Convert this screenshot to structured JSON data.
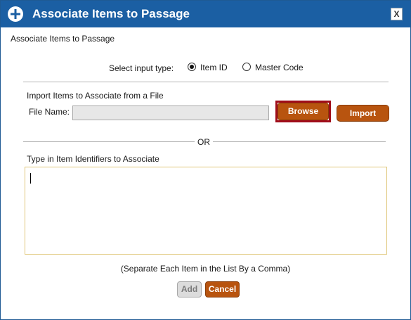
{
  "dialog": {
    "title": "Associate Items to Passage",
    "close_label": "X",
    "subtitle": "Associate Items to Passage"
  },
  "input_type": {
    "label": "Select input type:",
    "options": [
      {
        "label": "Item ID",
        "selected": true
      },
      {
        "label": "Master Code",
        "selected": false
      }
    ]
  },
  "import": {
    "section_label": "Import Items to Associate from a File",
    "file_name_label": "File Name:",
    "file_name_value": "",
    "browse_label": "Browse",
    "import_label": "Import"
  },
  "separator": {
    "or_label": "OR"
  },
  "manual": {
    "section_label": "Type in Item Identifiers to Associate",
    "value": "",
    "hint": "(Separate Each Item in the List By a Comma)"
  },
  "footer": {
    "add_label": "Add",
    "add_enabled": false,
    "cancel_label": "Cancel"
  },
  "colors": {
    "titlebar": "#1b5fa3",
    "button": "#b8540f",
    "highlight": "#a00d1a",
    "textarea_border": "#e0c77a"
  }
}
